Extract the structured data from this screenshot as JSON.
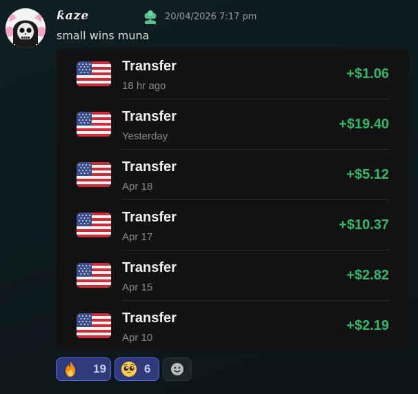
{
  "message": {
    "author": "ƙaze",
    "timestamp": "20/04/2026 7:17 pm",
    "text": "small wins muna",
    "avatar_icon": "skull-avatar-icon",
    "badge_icon": "clover-badge-icon"
  },
  "transfers": [
    {
      "title": "Transfer",
      "date": "18 hr ago",
      "amount": "+$1.06",
      "flag_icon": "us-flag-icon"
    },
    {
      "title": "Transfer",
      "date": "Yesterday",
      "amount": "+$19.40",
      "flag_icon": "us-flag-icon"
    },
    {
      "title": "Transfer",
      "date": "Apr 18",
      "amount": "+$5.12",
      "flag_icon": "us-flag-icon"
    },
    {
      "title": "Transfer",
      "date": "Apr 17",
      "amount": "+$10.37",
      "flag_icon": "us-flag-icon"
    },
    {
      "title": "Transfer",
      "date": "Apr 15",
      "amount": "+$2.82",
      "flag_icon": "us-flag-icon"
    },
    {
      "title": "Transfer",
      "date": "Apr 10",
      "amount": "+$2.19",
      "flag_icon": "us-flag-icon"
    }
  ],
  "reactions": [
    {
      "emoji_icon": "fire-emoji-icon",
      "count": "19",
      "active": true
    },
    {
      "emoji_icon": "pleading-face-emoji-icon",
      "count": "6",
      "active": true
    }
  ],
  "add_reaction": {
    "icon": "add-reaction-smiley-icon"
  },
  "colors": {
    "background": "#0d1a1d",
    "card": "#121212",
    "amount_green": "#33b86a",
    "reaction_active_bg": "#2f3a78",
    "reaction_active_border": "#5865f2"
  }
}
